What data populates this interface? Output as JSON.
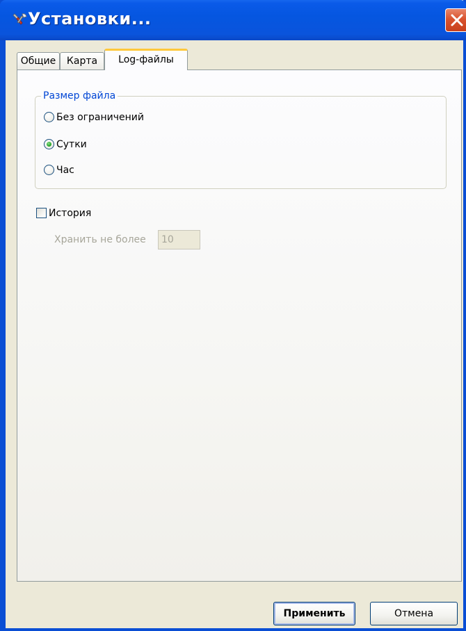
{
  "window": {
    "title": "Установки...",
    "title_icon": "tools-icon",
    "close_icon": "close-icon"
  },
  "tabs": [
    {
      "label": "Общие",
      "active": false
    },
    {
      "label": "Карта",
      "active": false
    },
    {
      "label": "Log-файлы",
      "active": true
    }
  ],
  "file_size_group": {
    "title": "Размер файла",
    "options": [
      {
        "label": "Без ограничений",
        "checked": false
      },
      {
        "label": "Сутки",
        "checked": true
      },
      {
        "label": "Час",
        "checked": false
      }
    ]
  },
  "history": {
    "label": "История",
    "checked": false,
    "keep_label": "Хранить не более",
    "keep_value": "10",
    "enabled": false
  },
  "buttons": {
    "apply_label": "Применить",
    "cancel_label": "Отмена"
  },
  "colors": {
    "titlebar": "#0a54dc",
    "group_title": "#0046d5",
    "close_button": "#d9532f",
    "active_tab_highlight": "#ffc83c",
    "disabled_text": "#a7a69a"
  }
}
